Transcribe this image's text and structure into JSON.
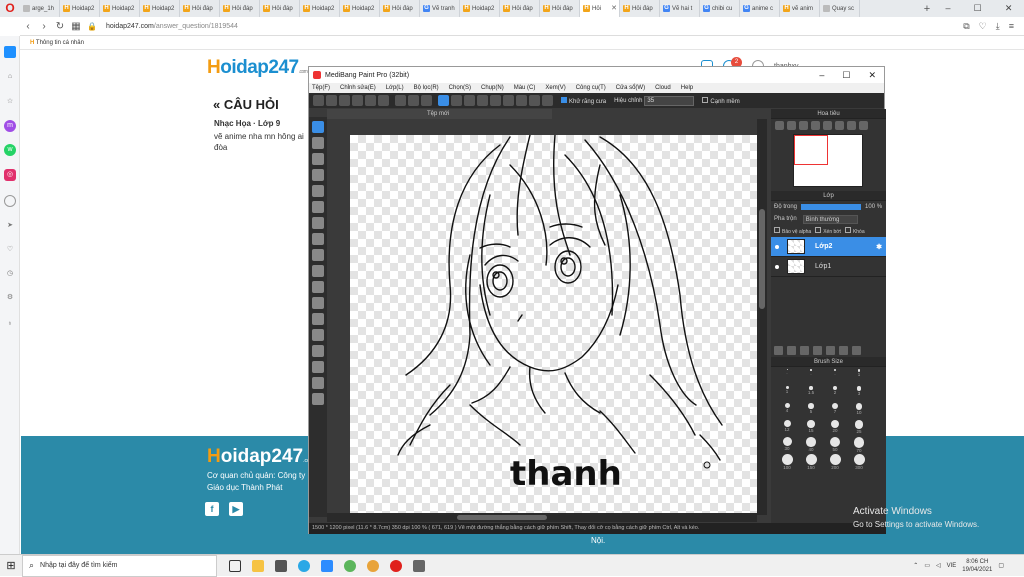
{
  "browser": {
    "tabs": [
      {
        "label": "arge_1h",
        "icon": "page-icon",
        "active": false
      },
      {
        "label": "Hoidap2",
        "icon": "h-icon",
        "active": false
      },
      {
        "label": "Hoidap2",
        "icon": "h-icon",
        "active": false
      },
      {
        "label": "Hoidap2",
        "icon": "h-icon",
        "active": false
      },
      {
        "label": "Hỏi đáp",
        "icon": "h-icon",
        "active": false
      },
      {
        "label": "Hỏi đáp",
        "icon": "h-icon",
        "active": false
      },
      {
        "label": "Hỏi đáp",
        "icon": "h-icon",
        "active": false
      },
      {
        "label": "Hoidap2",
        "icon": "h-icon",
        "active": false
      },
      {
        "label": "Hoidap2",
        "icon": "h-icon",
        "active": false
      },
      {
        "label": "Hỏi đáp",
        "icon": "h-icon",
        "active": false
      },
      {
        "label": "Vẽ tranh",
        "icon": "g-icon",
        "active": false
      },
      {
        "label": "Hoidap2",
        "icon": "h-icon",
        "active": false
      },
      {
        "label": "Hỏi đáp",
        "icon": "h-icon",
        "active": false
      },
      {
        "label": "Hỏi đáp",
        "icon": "h-icon",
        "active": false
      },
      {
        "label": "Hỏi",
        "icon": "h-icon",
        "active": true
      },
      {
        "label": "Hỏi đáp",
        "icon": "h-icon",
        "active": false
      },
      {
        "label": "Vẽ hai t",
        "icon": "g-icon",
        "active": false
      },
      {
        "label": "chibi cu",
        "icon": "g-icon",
        "active": false
      },
      {
        "label": "anime c",
        "icon": "g-icon",
        "active": false
      },
      {
        "label": "vẽ anim",
        "icon": "h-icon",
        "active": false
      },
      {
        "label": "Quay sc",
        "icon": "page-icon",
        "active": false
      }
    ],
    "url_host": "hoidap247.com",
    "url_path": "/answer_question/1819544",
    "bookmark": "Thông tin cá nhân"
  },
  "site": {
    "logo_h": "H",
    "logo_rest": "oidap247",
    "logo_com": ".com",
    "section_title": "« CÂU HỎI",
    "question_meta": "Nhạc Họa · Lớp 9",
    "question_text": "vẽ anime nha mn hông ai đòa",
    "user_name": "thanhxv..."
  },
  "footer": {
    "logo_h": "H",
    "logo_rest": "oidap247",
    "logo_com": ".com",
    "line1": "Cơ quan chủ quản: Công ty",
    "line2": "Giáo dục Thành Phát",
    "noi": "Nội."
  },
  "medibang": {
    "title": "MediBang Paint Pro (32bit)",
    "menu": [
      "Tệp(F)",
      "Chỉnh sửa(E)",
      "Lớp(L)",
      "Bộ lọc(R)",
      "Chọn(S)",
      "Chụp(N)",
      "Màu (C)",
      "Xem(V)",
      "Công cụ(T)",
      "Cửa sổ(W)",
      "Cloud",
      "Help"
    ],
    "antialias_label": "Khử răng cưa",
    "correction_label": "Hiệu chỉnh",
    "correction_value": "35",
    "hand_guard_label": "Cạnh mềm",
    "doc_tab": "Tệp mới",
    "canvas_text": "thanh",
    "status": "1500 * 1200 pixel   (11.6 * 8.7cm)   350 dpi   100 %   ( 671, 619 )   Vẽ một đường thẳng bằng cách giữ phím Shift, Thay đổi cỡ cọ bằng cách giữ phím Ctrl, Alt và kéo.",
    "navigator_label": "Hoa tiêu",
    "layer_panel_label": "Lớp",
    "opacity_label": "Độ trong",
    "opacity_value": "100 %",
    "opacity_level": 1.0,
    "blend_label": "Pha trộn",
    "blend_value": "Bình thường",
    "protect_alpha": "Bảo vệ alpha",
    "clipping": "Xén bớt",
    "lock": "Khóa",
    "layers": [
      {
        "name": "Lớp2",
        "active": true
      },
      {
        "name": "Lớp1",
        "active": false
      }
    ],
    "brush_size_label": "Brush Size",
    "brush_sizes": [
      ".",
      ".",
      ".",
      "1",
      "1",
      "1.5",
      "2",
      "3",
      "4",
      "5",
      "7",
      "10",
      "12",
      "15",
      "20",
      "25",
      "30",
      "40",
      "50",
      "70",
      "100",
      "150",
      "200",
      "300"
    ]
  },
  "watermark": {
    "line1": "Activate Windows",
    "line2": "Go to Settings to activate Windows."
  },
  "taskbar": {
    "search_placeholder": "Nhập tại đây để tìm kiếm",
    "lang": "VIE",
    "time": "8:06 CH",
    "date": "19/04/2021"
  },
  "colors": {
    "accent_blue": "#3a8ee6",
    "site_blue": "#1b8fd0",
    "footer_teal": "#2b8aa8",
    "brand_orange": "#f39c12"
  }
}
